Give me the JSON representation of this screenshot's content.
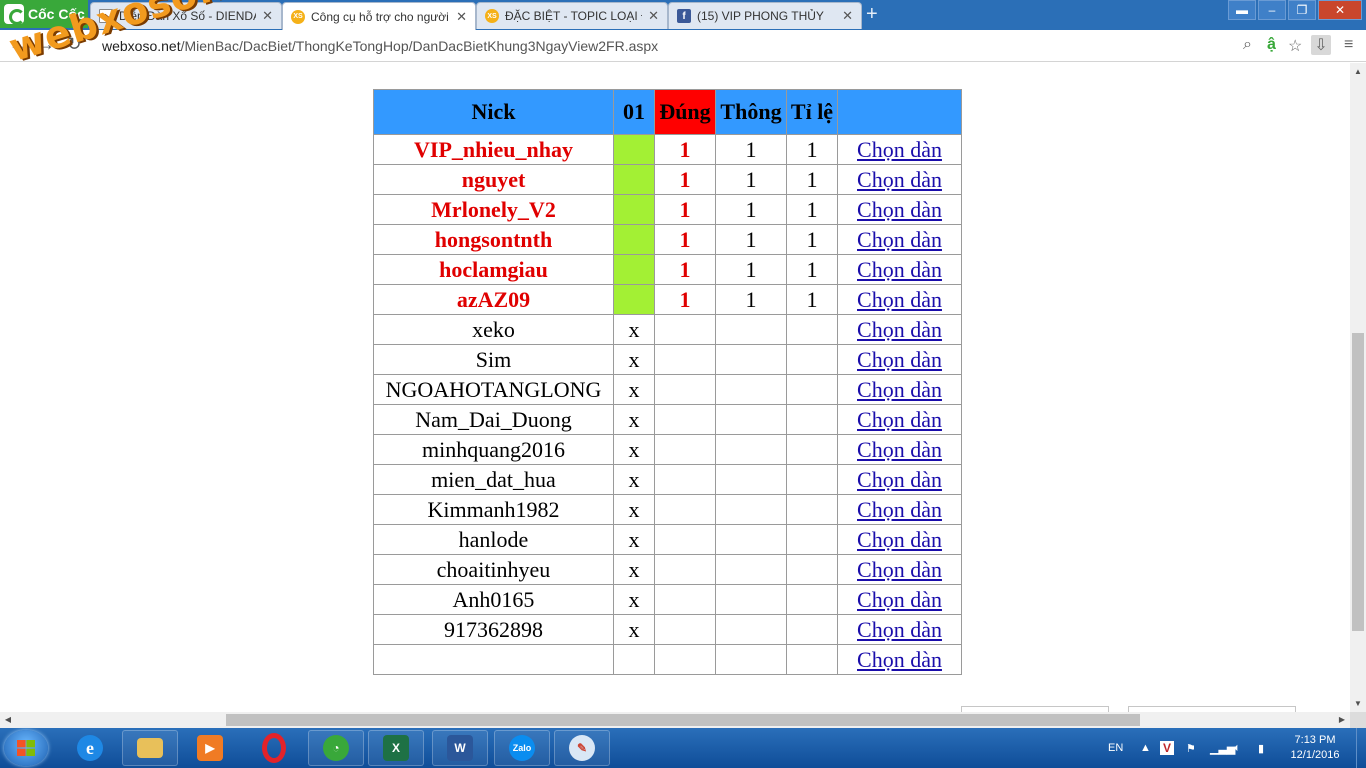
{
  "browser": {
    "brand": "Cốc Cốc",
    "tabs": [
      {
        "title": "Diễn Đàn Xổ Số - DIENDAN",
        "favicon": "page-icon",
        "active": false
      },
      {
        "title": "Công cụ hỗ trợ cho người",
        "favicon": "xs",
        "active": true
      },
      {
        "title": "ĐẶC BIỆT - TOPIC LOẠI ĐẶ",
        "favicon": "xs",
        "active": false
      },
      {
        "title": "(15) VIP PHONG THỦY",
        "favicon": "f",
        "active": false
      }
    ],
    "url_host": "webxoso.net",
    "url_path": "/MienBac/DacBiet/ThongKeTongHop/DanDacBietKhung3NgayView2FR.aspx",
    "translate_icon": "ậ"
  },
  "watermark": "webxoso.net",
  "table": {
    "headers": {
      "nick": "Nick",
      "col01": "01",
      "dung": "Đúng",
      "thong": "Thông",
      "tile": "Tỉ lệ",
      "action": ""
    },
    "rows": [
      {
        "nick": "VIP_nhieu_nhay",
        "col01": "",
        "dung": "1",
        "thong": "1",
        "tile": "1",
        "action": "Chọn dàn",
        "hit": true
      },
      {
        "nick": "nguyet",
        "col01": "",
        "dung": "1",
        "thong": "1",
        "tile": "1",
        "action": "Chọn dàn",
        "hit": true
      },
      {
        "nick": "Mrlonely_V2",
        "col01": "",
        "dung": "1",
        "thong": "1",
        "tile": "1",
        "action": "Chọn dàn",
        "hit": true
      },
      {
        "nick": "hongsontnth",
        "col01": "",
        "dung": "1",
        "thong": "1",
        "tile": "1",
        "action": "Chọn dàn",
        "hit": true
      },
      {
        "nick": "hoclamgiau",
        "col01": "",
        "dung": "1",
        "thong": "1",
        "tile": "1",
        "action": "Chọn dàn",
        "hit": true
      },
      {
        "nick": "azAZ09",
        "col01": "",
        "dung": "1",
        "thong": "1",
        "tile": "1",
        "action": "Chọn dàn",
        "hit": true
      },
      {
        "nick": "xeko",
        "col01": "x",
        "dung": "",
        "thong": "",
        "tile": "",
        "action": "Chọn dàn",
        "hit": false
      },
      {
        "nick": "Sim",
        "col01": "x",
        "dung": "",
        "thong": "",
        "tile": "",
        "action": "Chọn dàn",
        "hit": false
      },
      {
        "nick": "NGOAHOTANGLONG",
        "col01": "x",
        "dung": "",
        "thong": "",
        "tile": "",
        "action": "Chọn dàn",
        "hit": false
      },
      {
        "nick": "Nam_Dai_Duong",
        "col01": "x",
        "dung": "",
        "thong": "",
        "tile": "",
        "action": "Chọn dàn",
        "hit": false
      },
      {
        "nick": "minhquang2016",
        "col01": "x",
        "dung": "",
        "thong": "",
        "tile": "",
        "action": "Chọn dàn",
        "hit": false
      },
      {
        "nick": "mien_dat_hua",
        "col01": "x",
        "dung": "",
        "thong": "",
        "tile": "",
        "action": "Chọn dàn",
        "hit": false
      },
      {
        "nick": "Kimmanh1982",
        "col01": "x",
        "dung": "",
        "thong": "",
        "tile": "",
        "action": "Chọn dàn",
        "hit": false
      },
      {
        "nick": "hanlode",
        "col01": "x",
        "dung": "",
        "thong": "",
        "tile": "",
        "action": "Chọn dàn",
        "hit": false
      },
      {
        "nick": "choaitinhyeu",
        "col01": "x",
        "dung": "",
        "thong": "",
        "tile": "",
        "action": "Chọn dàn",
        "hit": false
      },
      {
        "nick": "Anh0165",
        "col01": "x",
        "dung": "",
        "thong": "",
        "tile": "",
        "action": "Chọn dàn",
        "hit": false
      },
      {
        "nick": "917362898",
        "col01": "x",
        "dung": "",
        "thong": "",
        "tile": "",
        "action": "Chọn dàn",
        "hit": false
      },
      {
        "nick": "",
        "col01": "",
        "dung": "",
        "thong": "",
        "tile": "",
        "action": "Chọn dàn",
        "hit": false
      }
    ]
  },
  "taskbar": {
    "apps": [
      "internet-explorer",
      "file-explorer",
      "media-player",
      "opera",
      "coccoc",
      "excel",
      "word",
      "zalo",
      "paint"
    ],
    "language": "EN",
    "time": "7:13 PM",
    "date": "12/1/2016"
  },
  "colors": {
    "header_bg": "#3399ff",
    "dung_header_bg": "#ff0000",
    "hit_text": "#e00000",
    "green_cell": "#a3f034",
    "link": "#1a0dab"
  }
}
